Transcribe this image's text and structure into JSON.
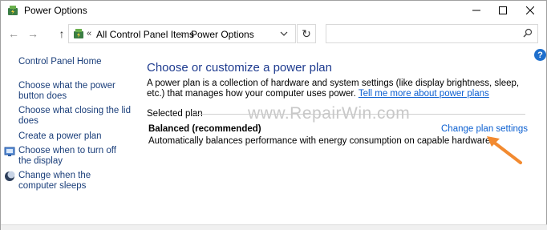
{
  "window": {
    "title": "Power Options",
    "app_icon": "power-options-icon",
    "controls": [
      "minimize-icon",
      "maximize-icon",
      "close-icon"
    ]
  },
  "address_bar": {
    "breadcrumb": [
      "All Control Panel Items",
      "Power Options"
    ],
    "overflow_marker": "«",
    "separator": "›",
    "search_placeholder": ""
  },
  "help_label": "?",
  "sidebar": {
    "home": "Control Panel Home",
    "items": [
      {
        "label": "Choose what the power button does",
        "icon": null
      },
      {
        "label": "Choose what closing the lid does",
        "icon": null
      },
      {
        "label": "Create a power plan",
        "icon": null
      },
      {
        "label": "Choose when to turn off the display",
        "icon": "display-shield-icon"
      },
      {
        "label": "Change when the computer sleeps",
        "icon": "sleep-moon-icon"
      }
    ]
  },
  "main": {
    "heading": "Choose or customize a power plan",
    "description": "A power plan is a collection of hardware and system settings (like display brightness, sleep, etc.) that manages how your computer uses power.",
    "description_link": "Tell me more about power plans",
    "section_label": "Selected plan",
    "plan": {
      "name": "Balanced (recommended)",
      "description": "Automatically balances performance with energy consumption on capable hardware.",
      "change_link": "Change plan settings"
    },
    "watermark": "www.RepairWin.com"
  },
  "colors": {
    "heading": "#1e3b8f",
    "link": "#0b5fd1",
    "sidebar_link": "#1a3e7a",
    "annotation_arrow": "#f28a30"
  }
}
